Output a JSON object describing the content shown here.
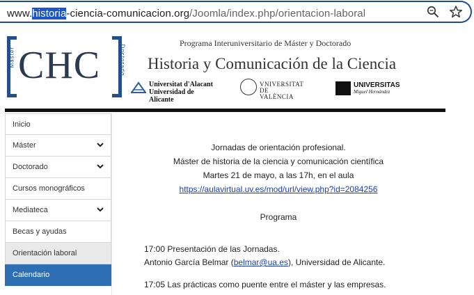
{
  "browser": {
    "url_prefix": "www.",
    "url_selected": "historia",
    "url_rest": "-ciencia-comunicacion.org",
    "url_path": "/Joomla/index.php/orientacion-laboral"
  },
  "header": {
    "logo_text": "CHC",
    "logo_left_vertical": "Máster",
    "logo_right_vertical": "Doctorado",
    "program_title": "Programa Interuniversitario de Máster y Doctorado",
    "site_title": "Historia y Comunicación de la Ciencia",
    "universities": [
      {
        "line1": "Universitat d'Alacant",
        "line2": "Universidad de Alicante"
      },
      {
        "line1": "VNIVERSITAT",
        "line2": "DE VALÈNCIA"
      },
      {
        "line1": "UNIVERSITAS",
        "line2": "Miguel Hernández"
      }
    ]
  },
  "sidebar": {
    "items": [
      {
        "label": "Inicio"
      },
      {
        "label": "Máster"
      },
      {
        "label": "Doctorado"
      },
      {
        "label": "Cursos monográficos"
      },
      {
        "label": "Mediateca"
      },
      {
        "label": "Becas y ayudas"
      },
      {
        "label": "Orientación laboral"
      },
      {
        "label": "Calendario"
      }
    ]
  },
  "content": {
    "line1": "Jornadas de orientación profesional.",
    "line2": "Máster de historia de la ciencia y comunicación científica",
    "line3": "Martes 21 de mayo, a las 17h, en el aula",
    "link": "https://aulavirtual.uv.es/mod/url/view.php?id=2084256",
    "programa": "Programa",
    "item1_title": "17:00 Presentación de las Jornadas.",
    "item1_person": "Antonio García Belmar (",
    "item1_email": "belmar@ua.es",
    "item1_affil": "), Universidad de Alicante.",
    "item2_title": "17:05 Las prácticas como puente entre el máster y las empresas."
  },
  "colors": {
    "accent": "#2d6fb2",
    "logo_blue": "#23508a",
    "link": "#1a3fa8"
  }
}
